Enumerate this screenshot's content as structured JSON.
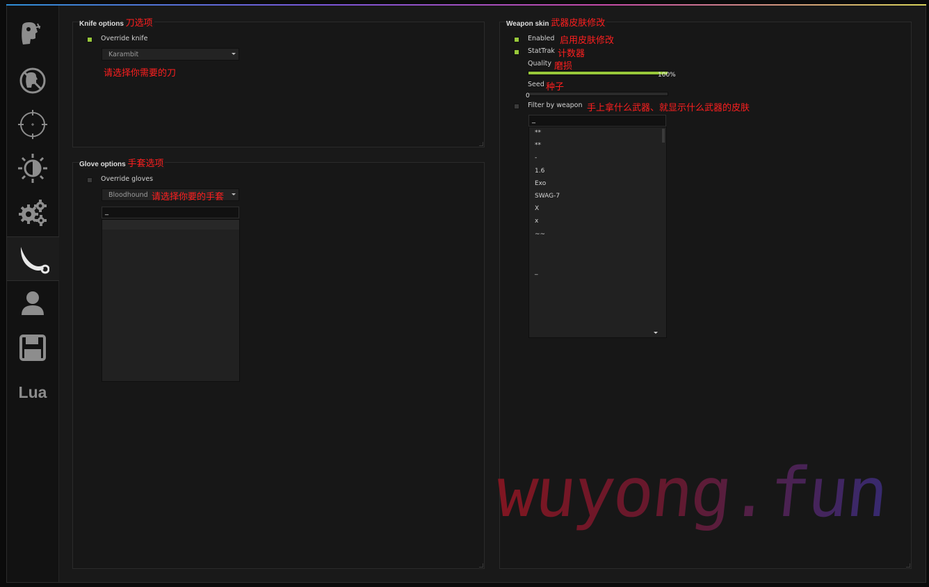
{
  "sidebar": {
    "tabs": [
      {
        "icon": "ragebot-head-icon"
      },
      {
        "icon": "antiaim-head-icon"
      },
      {
        "icon": "crosshair-icon"
      },
      {
        "icon": "visuals-contrast-icon"
      },
      {
        "icon": "gears-icon"
      },
      {
        "icon": "knife-icon"
      },
      {
        "icon": "user-icon"
      },
      {
        "icon": "save-icon"
      },
      {
        "label": "Lua"
      }
    ],
    "active_index": 5
  },
  "knife": {
    "title": "Knife options",
    "title_note": "刀选项",
    "override_label": "Override knife",
    "override_checked": true,
    "model_value": "Karambit",
    "model_note": "请选择你需要的刀"
  },
  "glove": {
    "title": "Glove options",
    "title_note": "手套选项",
    "override_label": "Override gloves",
    "override_checked": false,
    "model_value": "Bloodhound",
    "model_note": "请选择你要的手套",
    "search_value": "_"
  },
  "weapon": {
    "title": "Weapon skin",
    "title_note": "武器皮肤修改",
    "enabled_label": "Enabled",
    "enabled_note": "启用皮肤修改",
    "enabled_checked": true,
    "stattrak_label": "StatTrak",
    "stattrak_note": "计数器",
    "stattrak_checked": true,
    "quality_label": "Quality",
    "quality_note": "磨损",
    "quality_value": "100%",
    "quality_fraction": 1.0,
    "seed_label": "Seed",
    "seed_note": "种子",
    "seed_value": "0",
    "seed_fraction": 0.0,
    "filter_label": "Filter by weapon",
    "filter_note": "手上拿什么武器、就显示什么武器的皮肤",
    "filter_checked": false,
    "search_value": "_",
    "skins": [
      "**",
      "**",
      "-",
      "1.6",
      "Exo",
      "SWAG-7",
      "X",
      "x",
      "~~",
      "",
      "",
      "_"
    ]
  },
  "watermark": "wuyong.fun",
  "colors": {
    "accent": "#98c83a",
    "annotation": "#ff1f1f",
    "background": "#191919"
  }
}
